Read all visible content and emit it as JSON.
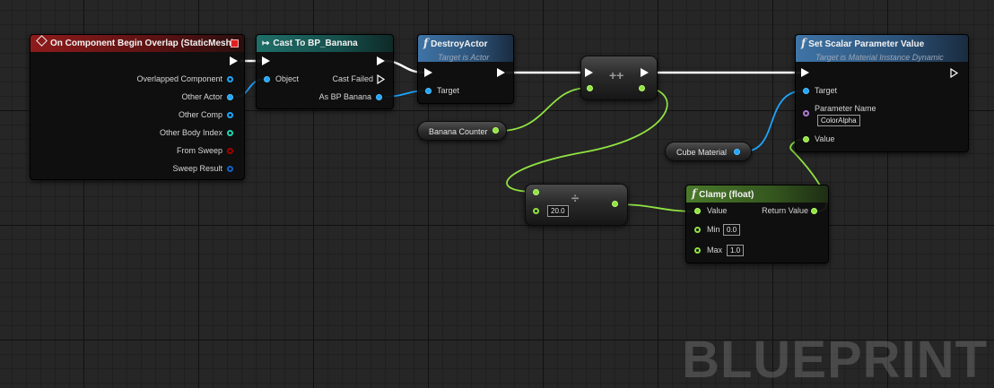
{
  "watermark": "BLUEPRINT",
  "colors": {
    "exec_wire": "#ffffff",
    "object_wire": "#1da6ff",
    "float_wire": "#90e342",
    "event_header": "#8f1b1b",
    "cast_header": "#1f6f6a",
    "function_header": "#3f74a6",
    "pure_function_header": "#4a7a2a"
  },
  "event_node": {
    "title": "On Component Begin Overlap (StaticMesh)",
    "icon": "event-diamond-icon",
    "pins": [
      "Overlapped Component",
      "Other Actor",
      "Other Comp",
      "Other Body Index",
      "From Sweep",
      "Sweep Result"
    ]
  },
  "cast_node": {
    "title": "Cast To BP_Banana",
    "icon": "cast-arrow-icon",
    "object_pin": "Object",
    "cast_failed_pin": "Cast Failed",
    "as_pin": "As BP Banana"
  },
  "destroy_node": {
    "title": "DestroyActor",
    "subtitle": "Target is Actor",
    "icon": "function-icon",
    "target_pin": "Target"
  },
  "increment_node": {
    "symbol": "++"
  },
  "banana_counter": {
    "label": "Banana Counter"
  },
  "divide_node": {
    "symbol": "÷",
    "input_value": "20.0"
  },
  "clamp_node": {
    "title": "Clamp (float)",
    "icon": "function-icon",
    "value_pin": "Value",
    "return_pin": "Return Value",
    "min_pin": "Min",
    "min_value": "0.0",
    "max_pin": "Max",
    "max_value": "1.0"
  },
  "cube_material": {
    "label": "Cube Material"
  },
  "set_scalar_node": {
    "title": "Set Scalar Parameter Value",
    "subtitle": "Target is Material Instance Dynamic",
    "icon": "function-icon",
    "target_pin": "Target",
    "param_name_pin": "Parameter Name",
    "param_name_value": "ColorAlpha",
    "value_pin": "Value"
  }
}
